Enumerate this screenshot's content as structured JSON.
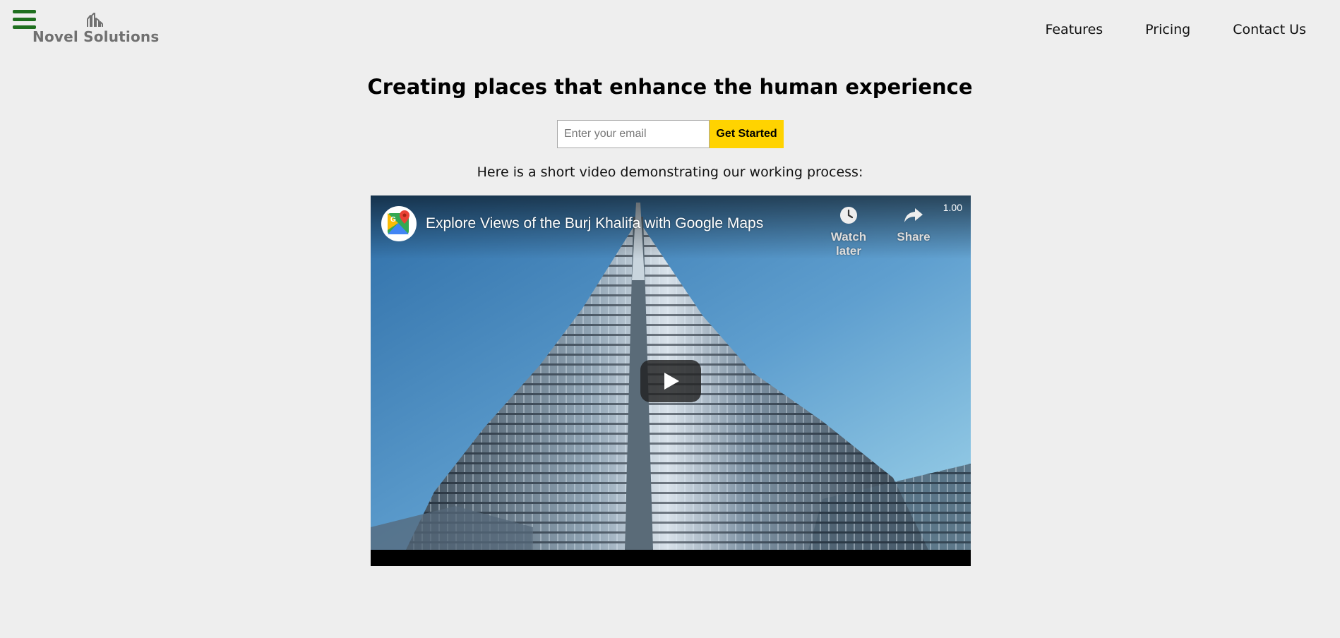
{
  "brand": {
    "name": "Novel Solutions",
    "menu_icon": "hamburger-menu-icon",
    "logo_icon": "building-icon",
    "menu_color": "#1e6f1e"
  },
  "nav": {
    "items": [
      {
        "label": "Features"
      },
      {
        "label": "Pricing"
      },
      {
        "label": "Contact Us"
      }
    ]
  },
  "hero": {
    "title": "Creating places that enhance the human experience",
    "email_placeholder": "Enter your email",
    "email_value": "",
    "cta_label": "Get Started",
    "cta_color": "#ffd300",
    "video_caption": "Here is a short video demonstrating our working process:"
  },
  "video": {
    "title": "Explore Views of the Burj Khalifa with Google Maps",
    "channel_icon": "google-maps-icon",
    "watch_later_label": "Watch later",
    "watch_later_icon": "clock-icon",
    "share_label": "Share",
    "share_icon": "share-arrow-icon",
    "speed": "1.00",
    "play_icon": "play-icon"
  }
}
